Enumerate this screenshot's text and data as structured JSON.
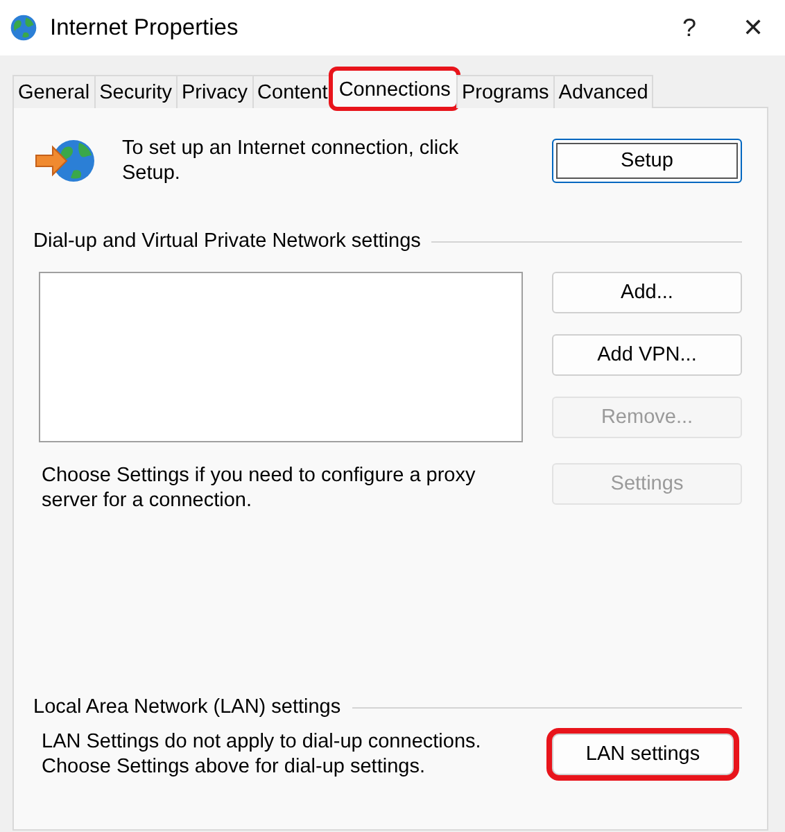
{
  "window": {
    "title": "Internet Properties",
    "help": "?",
    "close": "✕"
  },
  "tabs": [
    {
      "label": "General",
      "selected": false,
      "highlighted": false
    },
    {
      "label": "Security",
      "selected": false,
      "highlighted": false
    },
    {
      "label": "Privacy",
      "selected": false,
      "highlighted": false
    },
    {
      "label": "Content",
      "selected": false,
      "highlighted": false
    },
    {
      "label": "Connections",
      "selected": true,
      "highlighted": true
    },
    {
      "label": "Programs",
      "selected": false,
      "highlighted": false
    },
    {
      "label": "Advanced",
      "selected": false,
      "highlighted": false
    }
  ],
  "setup": {
    "text": "To set up an Internet connection, click Setup.",
    "button": {
      "label": "Setup",
      "default": true
    }
  },
  "dialup": {
    "heading": "Dial-up and Virtual Private Network settings",
    "buttons": [
      {
        "label": "Add...",
        "disabled": false
      },
      {
        "label": "Add VPN...",
        "disabled": false
      },
      {
        "label": "Remove...",
        "disabled": true
      }
    ],
    "proxy_text": "Choose Settings if you need to configure a proxy server for a connection.",
    "settings_button": {
      "label": "Settings",
      "disabled": true
    }
  },
  "lan": {
    "heading": "Local Area Network (LAN) settings",
    "text": "LAN Settings do not apply to dial-up connections. Choose Settings above for dial-up settings.",
    "button": {
      "label": "LAN settings",
      "highlighted": true
    }
  }
}
